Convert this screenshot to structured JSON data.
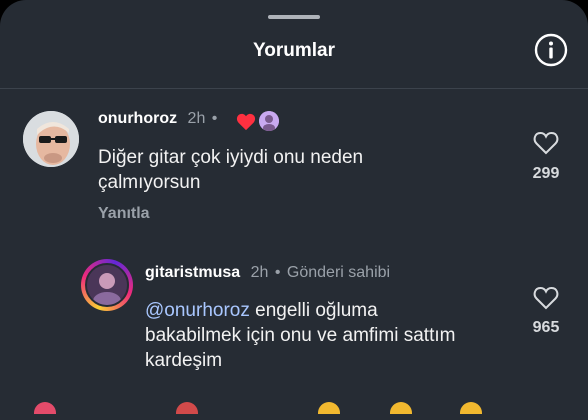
{
  "header": {
    "title": "Yorumlar",
    "info_icon": "info-icon"
  },
  "comments": [
    {
      "username": "onurhoroz",
      "time": "2h",
      "separator": "•",
      "text_line1": "Diğer gitar çok iyiydi onu neden",
      "text_line2": "çalmıyorsun",
      "reply_label": "Yanıtla",
      "like_count": "299"
    }
  ],
  "replies": [
    {
      "username": "gitaristmusa",
      "time": "2h",
      "separator": "•",
      "badge": "Gönderi sahibi",
      "mention": "@onurhoroz",
      "text_rest_line1": " engelli oğluma",
      "text_line2": "bakabilmek için onu ve amfimi sattım",
      "text_line3": "kardeşim",
      "like_count": "965"
    }
  ],
  "colors": {
    "background": "#262c34",
    "heart_red": "#ff3040",
    "mention": "#a9c7ff"
  }
}
